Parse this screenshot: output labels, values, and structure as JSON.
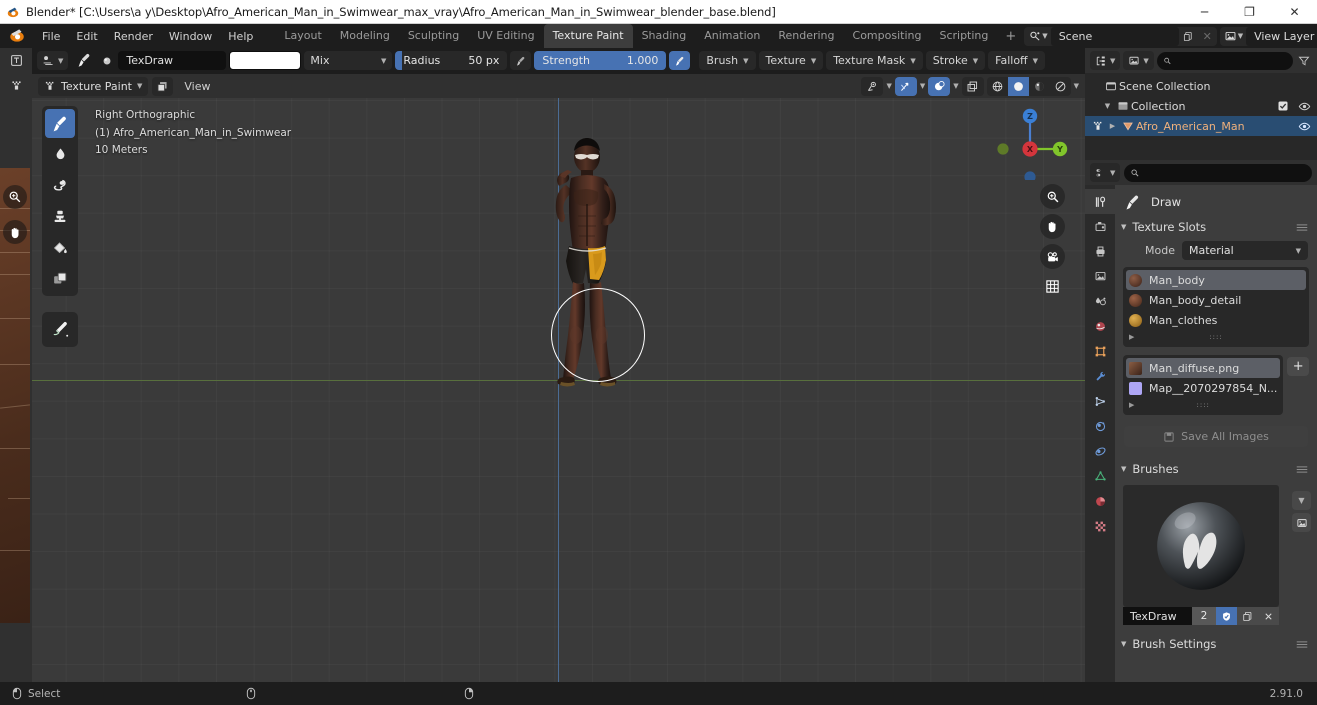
{
  "window": {
    "title": "Blender* [C:\\Users\\a y\\Desktop\\Afro_American_Man_in_Swimwear_max_vray\\Afro_American_Man_in_Swimwear_blender_base.blend]",
    "minimize": "─",
    "maximize": "❐",
    "close": "✕"
  },
  "menus": [
    "File",
    "Edit",
    "Render",
    "Window",
    "Help"
  ],
  "workspaces": {
    "tabs": [
      "Layout",
      "Modeling",
      "Sculpting",
      "UV Editing",
      "Texture Paint",
      "Shading",
      "Animation",
      "Rendering",
      "Compositing",
      "Scripting"
    ],
    "active": "Texture Paint",
    "add": "+"
  },
  "scene": {
    "name": "Scene",
    "view_layer": "View Layer"
  },
  "tool_header": {
    "brush_name": "TexDraw",
    "color": "#ffffff",
    "blend_mode": "Mix",
    "radius_label": "Radius",
    "radius_value": "50 px",
    "strength_label": "Strength",
    "strength_value": "1.000",
    "dropdowns": [
      "Brush",
      "Texture",
      "Texture Mask",
      "Stroke",
      "Falloff"
    ]
  },
  "viewport_header": {
    "mode": "Texture Paint",
    "view_menu": "View"
  },
  "viewport": {
    "view_name": "Right Orthographic",
    "object_line": "(1) Afro_American_Man_in_Swimwear",
    "scale_line": "10 Meters",
    "gizmo_axes": [
      {
        "label": "Z",
        "color": "#3a7fd5"
      },
      {
        "label": "X",
        "color": "#d4353c"
      },
      {
        "label": "Y",
        "color": "#80c42a"
      }
    ],
    "tools": [
      "draw-brush-tool",
      "soften-tool",
      "smear-tool",
      "clone-tool",
      "fill-tool",
      "mask-tool",
      "annotate-tool"
    ],
    "nav_buttons": [
      "zoom-icon",
      "pan-hand-icon",
      "camera-icon",
      "grid-icon"
    ]
  },
  "outliner": {
    "search_placeholder": "",
    "rows": [
      {
        "label": "Scene Collection",
        "icon": "collection-icon",
        "depth": 0,
        "selected": false,
        "expander": "",
        "checkbox": false,
        "eye": false
      },
      {
        "label": "Collection",
        "icon": "collection-icon",
        "depth": 1,
        "selected": false,
        "expander": "▼",
        "checkbox": true,
        "eye": true
      },
      {
        "label": "Afro_American_Man",
        "icon": "mesh-object-icon",
        "depth": 2,
        "selected": true,
        "expander": "▶",
        "checkbox": false,
        "eye": true
      }
    ]
  },
  "properties": {
    "active_tool_title": "Draw",
    "panels": {
      "texture_slots": {
        "title": "Texture Slots",
        "mode_label": "Mode",
        "mode_value": "Material",
        "materials": [
          {
            "name": "Man_body",
            "selected": true,
            "color": "#5e3b2c"
          },
          {
            "name": "Man_body_detail",
            "selected": false,
            "color": "#7a4a34"
          },
          {
            "name": "Man_clothes",
            "selected": false,
            "color": "#c48a2a"
          }
        ],
        "textures": [
          {
            "name": "Man_diffuse.png",
            "selected": true,
            "color": "#6b4a38"
          },
          {
            "name": "Map__2070297854_N...",
            "selected": false,
            "color": "#a9a1f0"
          }
        ],
        "add_button": "+",
        "save_all": "Save All Images"
      },
      "brushes": {
        "title": "Brushes",
        "name": "TexDraw",
        "users": "2",
        "fake_user_icon": "shield-icon",
        "duplicate_icon": "copy-icon",
        "unlink_icon": "x-icon"
      },
      "brush_settings": {
        "title": "Brush Settings"
      }
    },
    "tabs": [
      "tool-tab",
      "render-tab",
      "output-tab",
      "view-layer-tab",
      "scene-tab",
      "world-tab",
      "object-tab",
      "modifier-tab",
      "particles-tab",
      "physics-tab",
      "constraints-tab",
      "data-tab",
      "material-tab",
      "texture-tab"
    ]
  },
  "statusbar": {
    "mouse_action": "Select",
    "version": "2.91.0"
  }
}
